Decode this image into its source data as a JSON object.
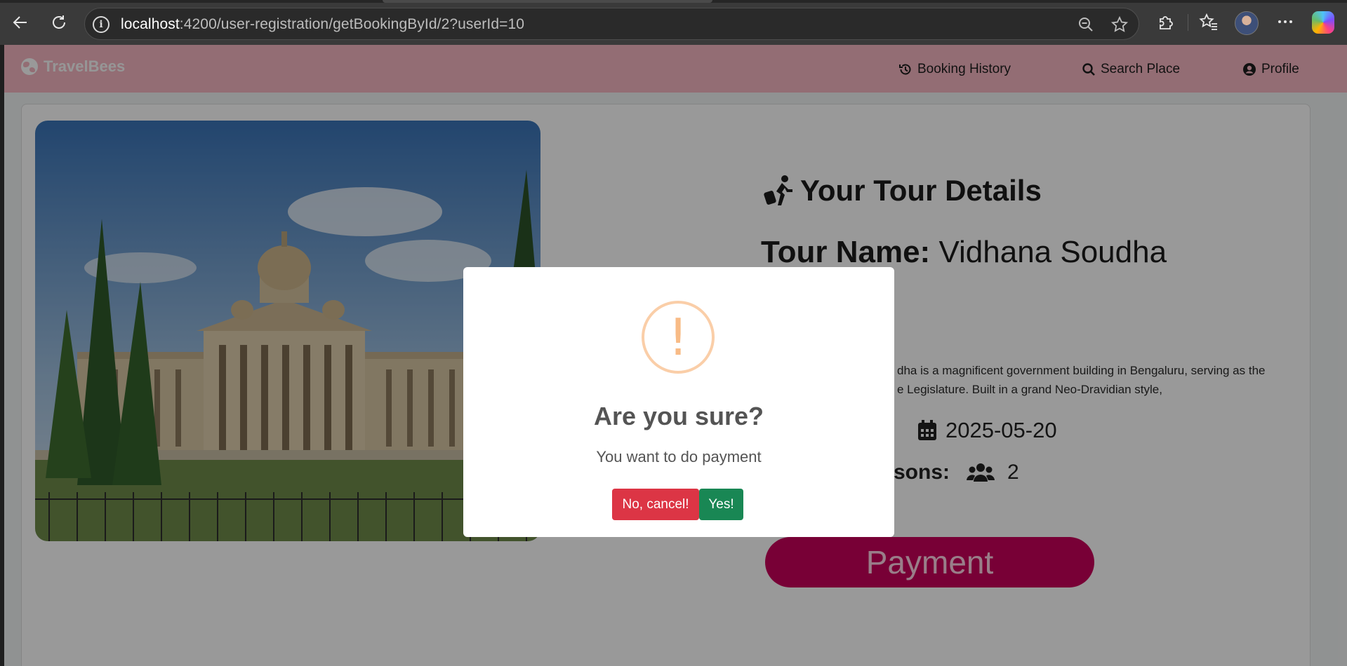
{
  "browser": {
    "url_host": "localhost",
    "url_rest": ":4200/user-registration/getBookingById/2?userId=10",
    "icons": [
      "back-icon",
      "refresh-icon",
      "site-info-icon",
      "zoom-out-icon",
      "favorite-star-icon",
      "extensions-icon",
      "favorites-icon",
      "profile-avatar",
      "more-icon",
      "copilot-icon"
    ]
  },
  "navbar": {
    "brand": "TravelBees",
    "links": [
      {
        "label": "Booking History",
        "icon": "history-icon"
      },
      {
        "label": "Search Place",
        "icon": "search-icon"
      },
      {
        "label": "Profile",
        "icon": "user-circle-icon"
      }
    ],
    "background": "#f6b6c1"
  },
  "tour": {
    "heading": "Your Tour Details",
    "name_label": "Tour Name:",
    "name_value": "Vidhana Soudha",
    "description_line1": "dha is a magnificent government building in Bengaluru, serving as the",
    "description_line2": "e Legislature. Built in a grand Neo-Dravidian style,",
    "date": "2025-05-20",
    "persons_label": "sons:",
    "persons_value": "2",
    "payment_label": "Payment",
    "payment_color": "#c8005a"
  },
  "modal": {
    "icon": "!",
    "title": "Are you sure?",
    "text": "You want to do payment",
    "cancel_label": "No, cancel!",
    "confirm_label": "Yes!",
    "cancel_color": "#dc3545",
    "confirm_color": "#198754"
  }
}
